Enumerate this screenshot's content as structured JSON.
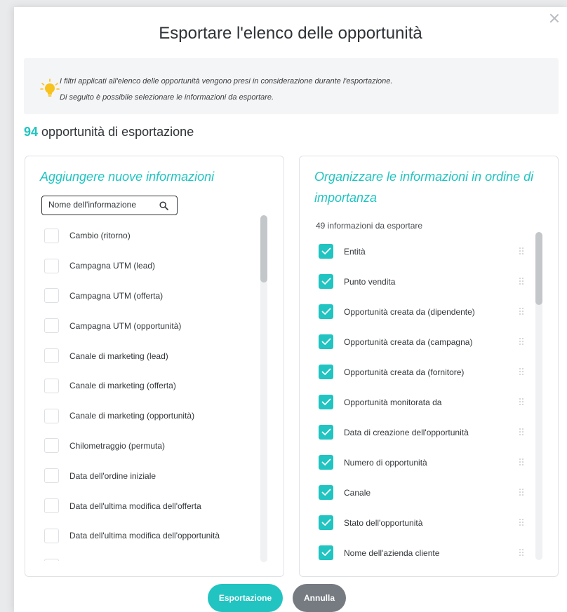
{
  "dialog": {
    "title": "Esportare l'elenco delle opportunità",
    "info_line1": "I filtri applicati all'elenco delle opportunità vengono presi in considerazione durante l'esportazione.",
    "info_line2": "Di seguito è possibile selezionare le informazioni da esportare.",
    "count_value": "94",
    "count_label": "opportunità di esportazione"
  },
  "left_panel": {
    "title": "Aggiungere nuove informazioni",
    "search_placeholder": "Nome dell'informazione",
    "items": [
      {
        "label": "Cambio (ritorno)"
      },
      {
        "label": "Campagna UTM (lead)"
      },
      {
        "label": "Campagna UTM (offerta)"
      },
      {
        "label": "Campagna UTM (opportunità)"
      },
      {
        "label": "Canale di marketing (lead)"
      },
      {
        "label": "Canale di marketing (offerta)"
      },
      {
        "label": "Canale di marketing (opportunità)"
      },
      {
        "label": "Chilometraggio (permuta)"
      },
      {
        "label": "Data dell'ordine iniziale"
      },
      {
        "label": "Data dell'ultima modifica dell'offerta"
      },
      {
        "label": "Data dell'ultima modifica dell'opportunità"
      }
    ]
  },
  "right_panel": {
    "title_line1": "Organizzare le informazioni in ordine di",
    "title_line2": "importanza",
    "subcaption": "49 informazioni da esportare",
    "items": [
      {
        "label": "Entità"
      },
      {
        "label": "Punto vendita"
      },
      {
        "label": "Opportunità creata da (dipendente)"
      },
      {
        "label": "Opportunità creata da (campagna)"
      },
      {
        "label": "Opportunità creata da (fornitore)"
      },
      {
        "label": "Opportunità monitorata da"
      },
      {
        "label": "Data di creazione dell'opportunità"
      },
      {
        "label": "Numero di opportunità"
      },
      {
        "label": "Canale"
      },
      {
        "label": "Stato dell'opportunità"
      },
      {
        "label": "Nome dell'azienda cliente"
      }
    ]
  },
  "buttons": {
    "export_label": "Esportazione",
    "cancel_label": "Annulla"
  },
  "colors": {
    "accent": "#21c4c1",
    "secondary_button": "#767b82",
    "bulb": "#f7c21d"
  },
  "icons": {
    "close": "close-icon",
    "info": "lightbulb-icon",
    "search": "search-icon",
    "checkbox_checked": "checkmark-icon",
    "drag": "drag-handle-icon"
  }
}
